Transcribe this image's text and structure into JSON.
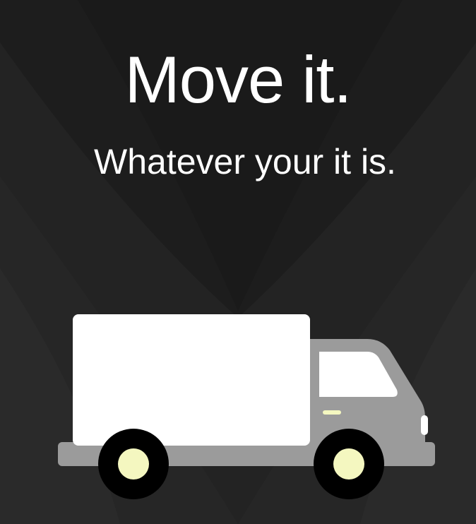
{
  "hero": {
    "headline": "Move it.",
    "tagline": "Whatever your it is."
  },
  "illustration": {
    "icon": "moving-truck-icon"
  },
  "colors": {
    "background": "#1e1e1e",
    "text": "#ffffff",
    "truck_box": "#ffffff",
    "truck_cab": "#9b9b9b",
    "tire": "#000000",
    "hub": "#f4f7c0"
  }
}
